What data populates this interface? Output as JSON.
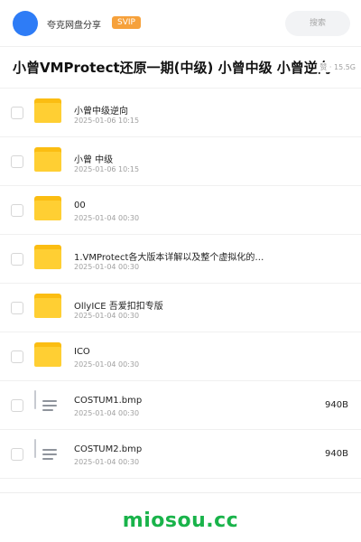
{
  "header": {
    "app_name": "夸克网盘分享",
    "badge": "SVIP",
    "search_placeholder": "搜索"
  },
  "title": {
    "text": "小曾VMProtect还原一期(中级) 小曾中级 小曾逆向",
    "meta": "赞 · 15.5G"
  },
  "items": [
    {
      "type": "folder",
      "name": "小曾中级逆向",
      "date": "2025-01-06 10:15",
      "size": ""
    },
    {
      "type": "folder",
      "name": "小曾 中级",
      "date": "2025-01-06 10:15",
      "size": ""
    },
    {
      "type": "folder",
      "name": "00",
      "date": "2025-01-04 00:30",
      "size": ""
    },
    {
      "type": "folder",
      "name": "1.VMProtect各大版本详解以及整个虚拟化的…",
      "date": "2025-01-04 00:30",
      "size": ""
    },
    {
      "type": "folder",
      "name": "OllyICE 吾爱扣扣专版",
      "date": "2025-01-04 00:30",
      "size": ""
    },
    {
      "type": "folder",
      "name": "ICO",
      "date": "2025-01-04 00:30",
      "size": ""
    },
    {
      "type": "file",
      "name": "COSTUM1.bmp",
      "date": "2025-01-04 00:30",
      "size": "940B"
    },
    {
      "type": "file",
      "name": "COSTUM2.bmp",
      "date": "2025-01-04 00:30",
      "size": "940B"
    }
  ],
  "footer": {
    "watermark": "miosou.cc"
  },
  "colors": {
    "avatar": "#2e7cf6",
    "badge": "#f6a13b",
    "folder": "#ffcf33",
    "watermark": "#19b34a"
  }
}
